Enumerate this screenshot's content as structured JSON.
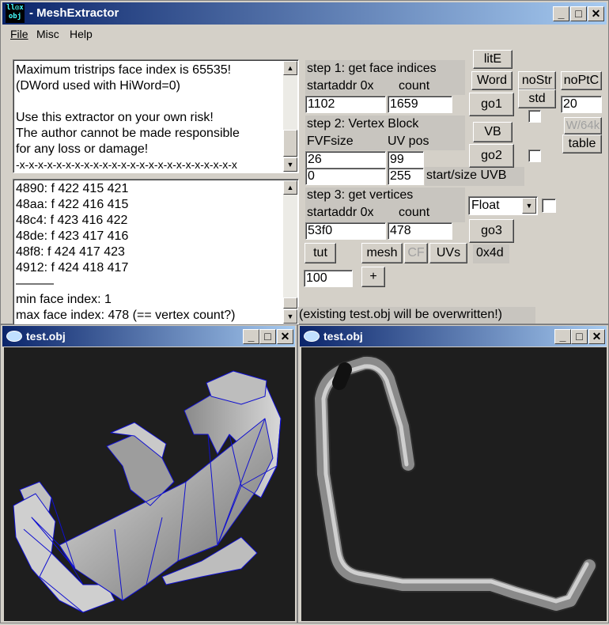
{
  "main_window": {
    "title": "MeshExtractor",
    "icon_text": [
      "ll◎x",
      "obj"
    ]
  },
  "menu": {
    "file": "File",
    "misc": "Misc",
    "help": "Help"
  },
  "info_text": [
    "  Maximum tristrips face index is 65535!",
    "  (DWord used with HiWord=0)",
    "",
    " Use this extractor on your own risk!",
    " The author cannot be made responsible",
    "       for any loss or damage!",
    "-x-x-x-x-x-x-x-x-x-x-x-x-x-x-x-x-x-x-x-x-x-x-x-x"
  ],
  "log_text": [
    "4890: f  422 415 421",
    "48aa: f  422 416 415",
    "48c4: f  423 416 422",
    "48de: f  423 417 416",
    "48f8: f  424 417 423",
    "4912: f  424 418 417",
    "  ———",
    "min face index: 1",
    "max face index: 478 (== vertex count?)"
  ],
  "step1": {
    "title": "step 1: get face indices",
    "startaddr_label": "startaddr 0x",
    "count_label": "count",
    "startaddr": "1102",
    "count": "1659"
  },
  "step2": {
    "title": "step 2: Vertex Block",
    "fvf_label": "FVFsize",
    "uvpos_label": "UV pos",
    "fvfsize": "26",
    "uvpos": "99",
    "start": "0",
    "size": "255",
    "startsize_label": "start/size UVB"
  },
  "step3": {
    "title": "step 3: get vertices",
    "startaddr_label": "startaddr 0x",
    "count_label": "count",
    "startaddr": "53f0",
    "count": "478",
    "format": "Float"
  },
  "buttons": {
    "lite": "litE",
    "word": "Word",
    "nostr": "noStr",
    "noptc": "noPtC",
    "go1": "go1",
    "std": "std",
    "w64k": "W/64k",
    "table": "table",
    "vb": "VB",
    "go2": "go2",
    "go3": "go3",
    "tut": "tut",
    "mesh": "mesh",
    "cf": "CF",
    "uvs": "UVs",
    "hex": "0x4d",
    "plus": "+"
  },
  "field_20": "20",
  "field_100": "100",
  "overwrite_note": "(existing test.obj will be overwritten!)",
  "viewer_left": {
    "title": "test.obj"
  },
  "viewer_right": {
    "title": "test.obj"
  },
  "colors": {
    "title_start": "#0a246a",
    "title_end": "#a6caf0",
    "wire": "#1010d0",
    "viewport_bg": "#1e1e1e"
  }
}
